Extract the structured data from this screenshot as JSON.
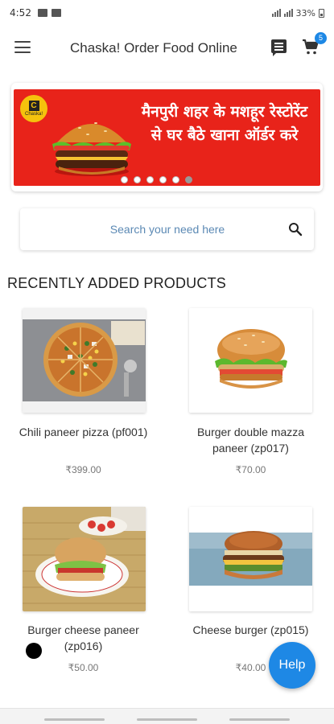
{
  "status_bar": {
    "time": "4:52",
    "battery_text": "33%"
  },
  "app_bar": {
    "title": "Chaska! Order Food Online",
    "cart_count": "5"
  },
  "banner": {
    "logo_letter": "C",
    "logo_text": "Chaska!",
    "text": "मैनपुरी शहर के मशहूर रेस्टोरेंट से घर बैठे खाना ऑर्डर करे",
    "slide_count": 6,
    "active_slide": 5
  },
  "search": {
    "placeholder": "Search your need here"
  },
  "section": {
    "title": "RECENTLY ADDED PRODUCTS"
  },
  "products": [
    {
      "name": "Chili paneer pizza (pf001)",
      "price": "₹399.00",
      "image": "pizza"
    },
    {
      "name": "Burger double mazza paneer (zp017)",
      "price": "₹70.00",
      "image": "burger"
    },
    {
      "name": "Burger cheese paneer (zp016)",
      "price": "₹50.00",
      "image": "burger-plate"
    },
    {
      "name": "Cheese burger (zp015)",
      "price": "₹40.00",
      "image": "burger-blue"
    }
  ],
  "fab": {
    "label": "Help"
  },
  "colors": {
    "accent": "#1e88e5",
    "banner_red": "#e8231a",
    "logo_yellow": "#f5c20d"
  }
}
